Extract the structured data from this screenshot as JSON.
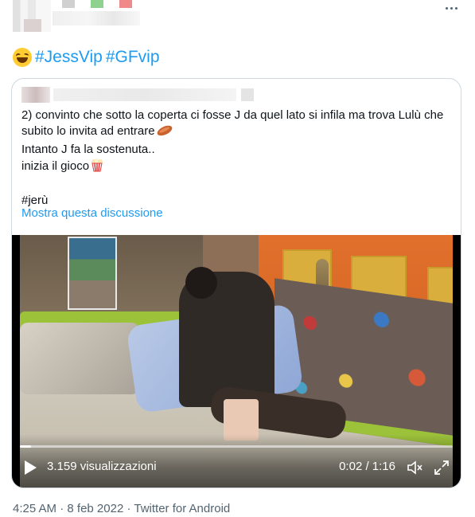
{
  "tweet": {
    "text_hashtags": [
      "#JessVip",
      "#GFvip"
    ],
    "emoji": "grinning-squinting-face",
    "more_options_icon": "more-horizontal-icon"
  },
  "quoted_tweet": {
    "lines": [
      "2) convinto che sotto la coperta ci fosse J da quel lato si infila ma trova Lulù che",
      "subito lo invita ad entrare",
      "Intanto J fa la sostenuta..",
      "inizia il gioco"
    ],
    "hashtag_line": "#jerù",
    "show_thread": "Mostra questa discussione",
    "emojis": [
      "sausage-icon",
      "popcorn-icon"
    ]
  },
  "video": {
    "views_label": "3.159 visualizzazioni",
    "time_label": "0:02 / 1:16",
    "progress": 0.026
  },
  "meta": {
    "time": "4:25 AM",
    "separator1": " · ",
    "date": "8 feb 2022",
    "separator2": " · ",
    "source": "Twitter for Android"
  },
  "colors": {
    "link": "#1d9bf0",
    "border": "#cfd9de",
    "secondary_text": "#536471"
  }
}
